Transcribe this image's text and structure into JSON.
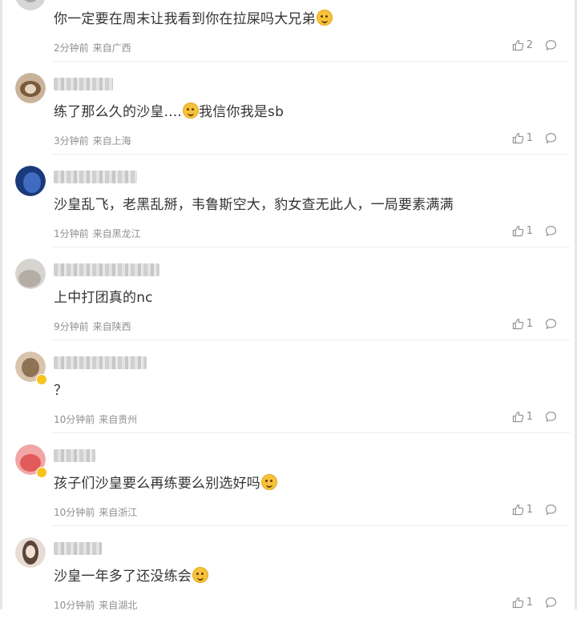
{
  "comments": [
    {
      "user": "user-1",
      "text": "你一定要在周末让我看到你在拉屎吗大兄弟",
      "emoji": "smile-emoji",
      "time": "2分钟前",
      "location": "来自广西",
      "likes": "2",
      "avatar_colors": [
        "#d6d6d6",
        "#a8a8a8"
      ]
    },
    {
      "user": "user-2",
      "text_before": "练了那么久的沙皇....",
      "emoji": "awkward-emoji",
      "text": "我信你我是sb",
      "time": "3分钟前",
      "location": "来自上海",
      "likes": "1",
      "avatar_colors": [
        "#c9b39a",
        "#7a5a3b"
      ]
    },
    {
      "user": "user-3",
      "text": "沙皇乱飞，老黑乱掰，韦鲁斯空大，豹女查无此人，一局要素满满",
      "time": "1分钟前",
      "location": "来自黑龙江",
      "likes": "1",
      "avatar_colors": [
        "#1b3a7a",
        "#3f6bc0"
      ]
    },
    {
      "user": "user-4",
      "text": "上中打团真的nc",
      "time": "9分钟前",
      "location": "来自陕西",
      "likes": "1",
      "avatar_colors": [
        "#d7d3cf",
        "#b3ada6"
      ]
    },
    {
      "user": "user-5",
      "text": "？",
      "time": "10分钟前",
      "location": "来自贵州",
      "likes": "1",
      "avatar_colors": [
        "#d9c4ad",
        "#8f7355"
      ]
    },
    {
      "user": "user-6",
      "text": "孩子们沙皇要么再练要么别选好吗",
      "emoji": "laugh-emoji",
      "time": "10分钟前",
      "location": "来自浙江",
      "likes": "1",
      "avatar_colors": [
        "#f1a6a6",
        "#e35a5a"
      ]
    },
    {
      "user": "user-7",
      "text": "沙皇一年多了还没练会",
      "emoji": "surprised-emoji",
      "time": "10分钟前",
      "location": "来自湖北",
      "likes": "1",
      "avatar_colors": [
        "#e7dcd4",
        "#5b4438"
      ]
    }
  ],
  "colors": {
    "text": "#333333",
    "meta": "#8f8f8f",
    "separator": "#ececec",
    "badge": "#f7c41e"
  }
}
